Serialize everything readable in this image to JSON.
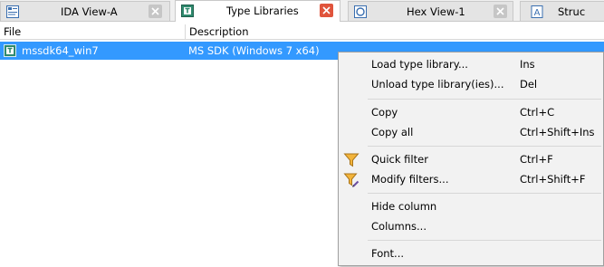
{
  "tabs": [
    {
      "label": "IDA View-A",
      "active": false,
      "icon": "ida-view-icon"
    },
    {
      "label": "Type Libraries",
      "active": true,
      "icon": "type-library-icon"
    },
    {
      "label": "Hex View-1",
      "active": false,
      "icon": "hex-view-icon"
    },
    {
      "label": "Struc",
      "active": false,
      "icon": "structures-icon"
    }
  ],
  "table": {
    "columns": [
      "File",
      "Description"
    ],
    "rows": [
      {
        "file": "mssdk64_win7",
        "description": "MS SDK (Windows 7 x64)",
        "icon": "type-library-icon"
      }
    ]
  },
  "context_menu": {
    "groups": [
      [
        {
          "label": "Load type library...",
          "shortcut": "Ins"
        },
        {
          "label": "Unload type library(ies)...",
          "shortcut": "Del"
        }
      ],
      [
        {
          "label": "Copy",
          "shortcut": "Ctrl+C"
        },
        {
          "label": "Copy all",
          "shortcut": "Ctrl+Shift+Ins"
        }
      ],
      [
        {
          "label": "Quick filter",
          "shortcut": "Ctrl+F",
          "icon": "funnel-icon"
        },
        {
          "label": "Modify filters...",
          "shortcut": "Ctrl+Shift+F",
          "icon": "funnel-edit-icon"
        }
      ],
      [
        {
          "label": "Hide column",
          "shortcut": ""
        },
        {
          "label": "Columns...",
          "shortcut": ""
        }
      ],
      [
        {
          "label": "Font...",
          "shortcut": ""
        }
      ]
    ]
  },
  "colors": {
    "selection": "#3399ff",
    "active_close": "#e0543c",
    "inactive_close": "#c6c6c6",
    "menu_bg": "#f2f2f2"
  }
}
